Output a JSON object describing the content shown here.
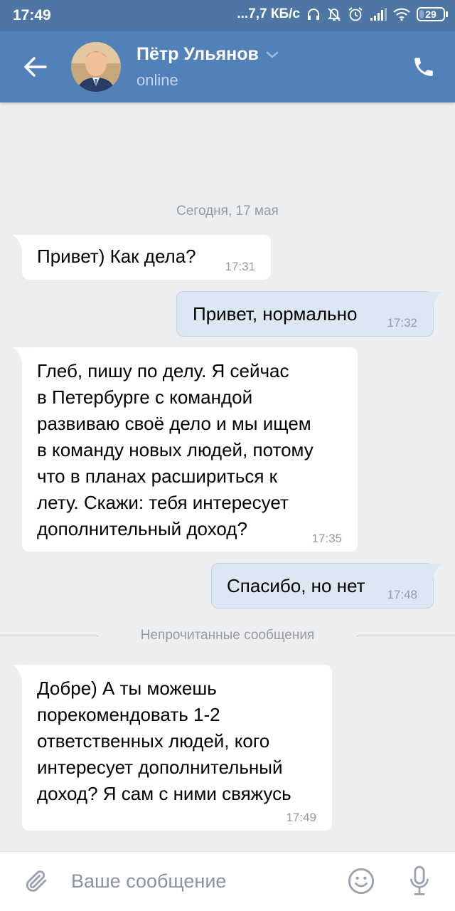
{
  "status_bar": {
    "time": "17:49",
    "network_speed": "...7,7 КБ/с",
    "battery": "29",
    "battery_level": 0.29,
    "icons": [
      "headphones-icon",
      "mute-bell-icon",
      "alarm-icon",
      "signal-icon",
      "wifi-icon",
      "battery-icon"
    ]
  },
  "header": {
    "contact_name": "Пётр Ульянов",
    "status": "online",
    "icons": {
      "back": "arrow-left-icon",
      "dropdown": "chevron-down-icon",
      "call": "phone-icon"
    }
  },
  "chat": {
    "date_separator": "Сегодня, 17 мая",
    "unread_separator": "Непрочитанные сообщения",
    "messages": [
      {
        "direction": "in",
        "text": "Привет) Как дела?",
        "time": "17:31"
      },
      {
        "direction": "out",
        "text": "Привет, нормально",
        "time": "17:32"
      },
      {
        "direction": "in",
        "text": "Глеб, пишу по делу. Я сейчас\nв Петербурге с командой\nразвиваю своё дело и мы ищем\nв команду новых людей, потому\nчто в планах расшириться к\nлету. Скажи: тебя интересует\nдополнительный доход?",
        "time": "17:35"
      },
      {
        "direction": "out",
        "text": "Спасибо, но нет",
        "time": "17:48"
      },
      {
        "direction": "in",
        "text": "Добре) А ты можешь\nпорекомендовать 1-2\nответственных людей, кого\nинтересует дополнительный\nдоход? Я сам с ними свяжусь",
        "time": "17:49"
      }
    ]
  },
  "composer": {
    "placeholder": "Ваше сообщение",
    "icons": {
      "attach": "paperclip-icon",
      "emoji": "smile-icon",
      "voice": "microphone-icon"
    }
  },
  "colors": {
    "header": "#5181b8",
    "status_bar": "#4d76a5",
    "background": "#edeef0",
    "incoming_bubble": "#ffffff",
    "outgoing_bubble": "#dce7f4",
    "muted_text": "#939ca6"
  }
}
